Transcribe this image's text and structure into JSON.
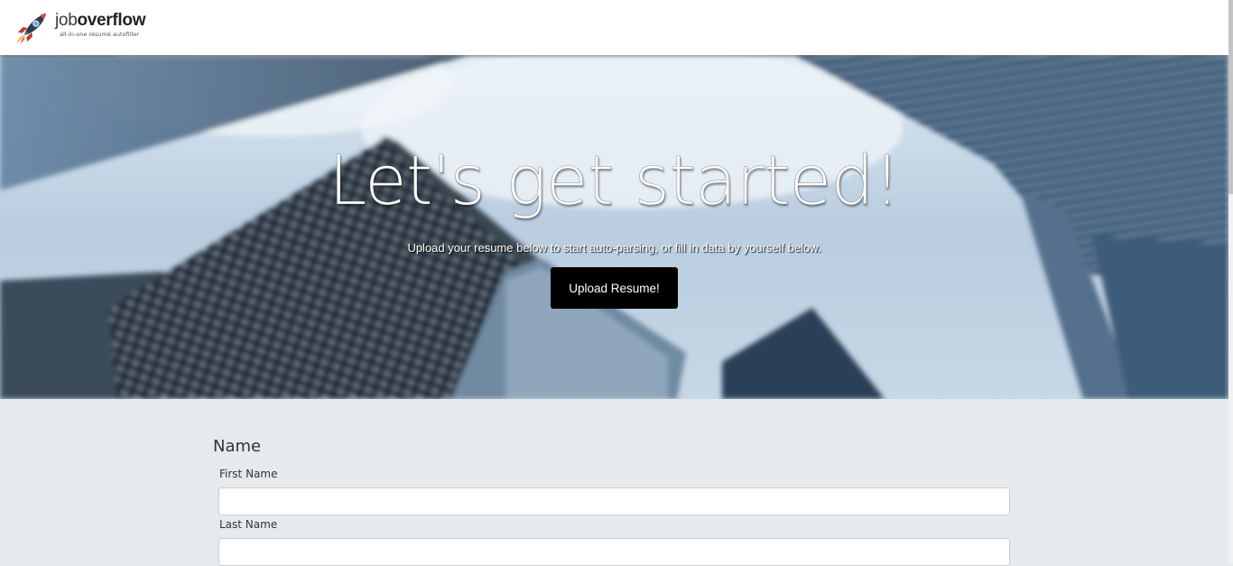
{
  "header": {
    "brand_name_light": "job",
    "brand_name_bold": "overflow",
    "brand_tagline": "all-in-one résumé autofiller",
    "logo_icon": "rocket-icon"
  },
  "hero": {
    "title": "Let's get started!",
    "subtitle": "Upload your resume below to start auto-parsing, or fill in data by yourself below.",
    "upload_button_label": "Upload Resume!",
    "background_image": "blurred-skyscrapers-photo"
  },
  "form": {
    "section_title": "Name",
    "fields": [
      {
        "label": "First Name",
        "value": "",
        "placeholder": ""
      },
      {
        "label": "Last Name",
        "value": "",
        "placeholder": ""
      }
    ]
  },
  "colors": {
    "accent": "#000000",
    "page_background": "#e6eaed",
    "header_background": "#ffffff"
  }
}
